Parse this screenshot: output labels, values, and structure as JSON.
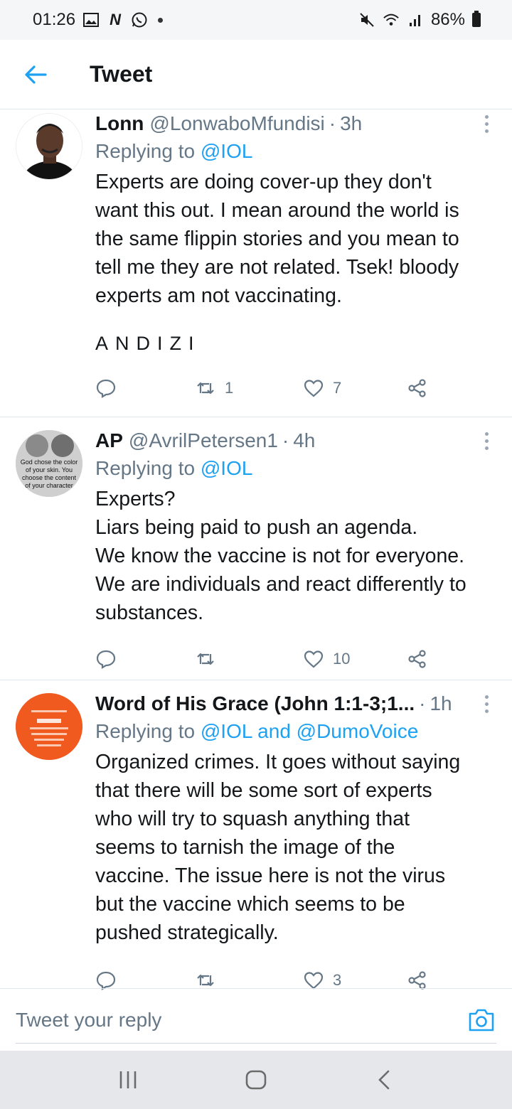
{
  "status_bar": {
    "time": "01:26",
    "battery": "86%",
    "left_icons": [
      "gallery-icon",
      "n-icon",
      "whatsapp-icon"
    ],
    "right_icons": [
      "mute-icon",
      "wifi-icon",
      "signal-icon",
      "battery-icon"
    ]
  },
  "header": {
    "title": "Tweet"
  },
  "tweets": [
    {
      "name": "Lonn",
      "handle": "@LonwaboMfundisi",
      "time": "3h",
      "replying_prefix": "Replying to ",
      "replying_to": "@IOL",
      "body": "Experts are doing cover-up they don't\nwant this out. I mean around the world is\nthe same flippin stories and you mean to\ntell me they are not related. Tsek! bloody\nexperts am not vaccinating.",
      "extra": "ANDIZI",
      "retweets": "1",
      "likes": "7"
    },
    {
      "name": "AP",
      "handle": "@AvrilPetersen1",
      "time": "4h",
      "replying_prefix": "Replying to ",
      "replying_to": "@IOL",
      "body": "Experts?\nLiars being paid to push an agenda.\nWe know the vaccine is not for everyone.\nWe are individuals and react differently to\nsubstances.",
      "retweets": "",
      "likes": "10",
      "avatar_text": "God chose the color of your skin. You choose the content of your character"
    },
    {
      "name": "Word of His Grace (John 1:1-3;1...",
      "handle": "",
      "time": "1h",
      "replying_prefix": "Replying to ",
      "replying_to": "@IOL and @DumoVoice",
      "body": "Organized crimes. It goes without saying\nthat there will be some sort of experts\nwho will try to squash anything that\nseems to tarnish the image of the\nvaccine. The issue here is not the virus\nbut the vaccine which seems to be\npushed strategically.",
      "retweets": "",
      "likes": "3"
    }
  ],
  "composer": {
    "placeholder": "Tweet your reply"
  },
  "colors": {
    "accent": "#1da1f2",
    "secondary_text": "#657786",
    "divider": "#e1e8ed"
  }
}
